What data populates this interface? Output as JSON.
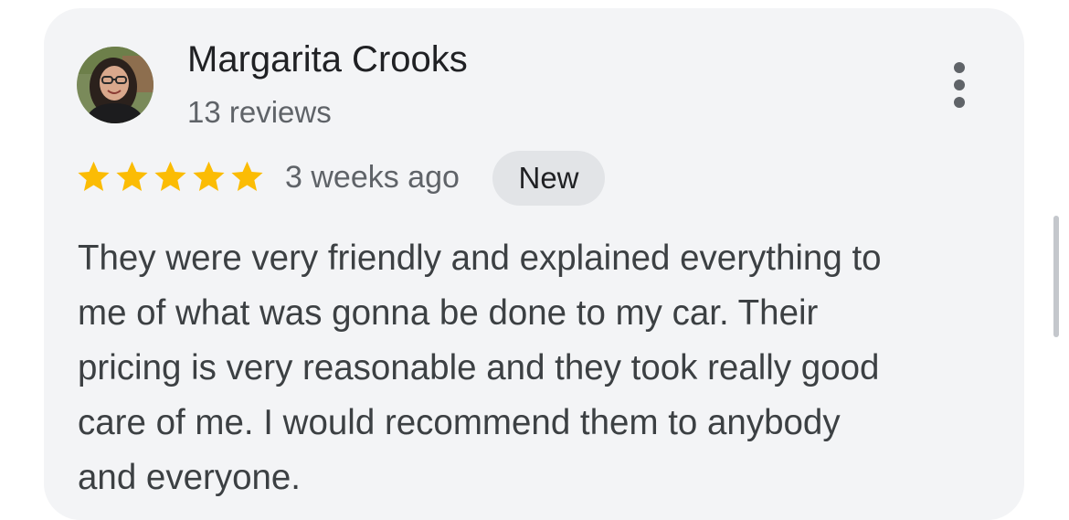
{
  "review": {
    "author_name": "Margarita Crooks",
    "author_review_count": "13 reviews",
    "rating": 5,
    "rating_max": 5,
    "time_ago": "3 weeks ago",
    "badge": "New",
    "lines": [
      "They were very friendly and explained everything to",
      "me of what was gonna be done to my car. Their",
      "pricing is very reasonable and they took really good",
      "care of me. I would recommend them to anybody",
      "and everyone."
    ]
  },
  "icons": {
    "avatar": "avatar-photo",
    "menu": "more-vert-icon",
    "star": "star-icon"
  },
  "colors": {
    "star": "#fbbc04",
    "card_background": "#f3f4f6",
    "badge_background": "#e2e4e7",
    "primary_text": "#202124",
    "secondary_text": "#5f6368"
  }
}
